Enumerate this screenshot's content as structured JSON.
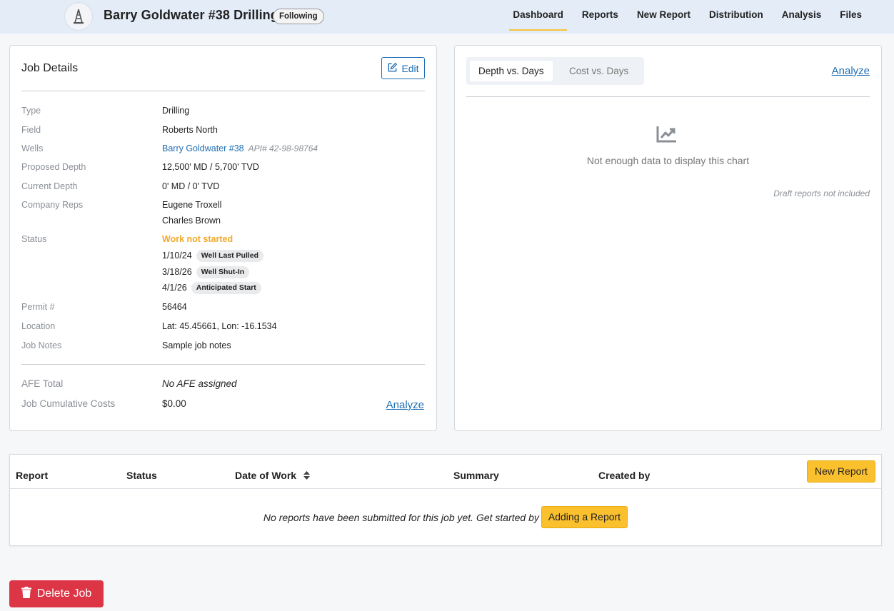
{
  "header": {
    "title": "Barry Goldwater #38 Drilling",
    "following_badge": "Following",
    "nav": [
      {
        "label": "Dashboard",
        "active": true
      },
      {
        "label": "Reports",
        "active": false
      },
      {
        "label": "New Report",
        "active": false
      },
      {
        "label": "Distribution",
        "active": false
      },
      {
        "label": "Analysis",
        "active": false
      },
      {
        "label": "Files",
        "active": false
      }
    ]
  },
  "job_details": {
    "title": "Job Details",
    "edit_label": "Edit",
    "fields": {
      "type": {
        "label": "Type",
        "value": "Drilling"
      },
      "field": {
        "label": "Field",
        "value": "Roberts North"
      },
      "wells": {
        "label": "Wells",
        "value": "Barry Goldwater #38",
        "api": "API# 42-98-98764"
      },
      "proposed_depth": {
        "label": "Proposed Depth",
        "value": "12,500' MD / 5,700' TVD"
      },
      "current_depth": {
        "label": "Current Depth",
        "value": "0' MD / 0' TVD"
      },
      "company_reps": {
        "label": "Company Reps",
        "values": [
          "Eugene Troxell",
          "Charles Brown"
        ]
      },
      "status": {
        "label": "Status",
        "value": "Work not started",
        "dates": [
          {
            "date": "1/10/24",
            "tag": "Well Last Pulled"
          },
          {
            "date": "3/18/26",
            "tag": "Well Shut-In"
          },
          {
            "date": "4/1/26",
            "tag": "Anticipated Start"
          }
        ]
      },
      "permit": {
        "label": "Permit #",
        "value": "56464"
      },
      "location": {
        "label": "Location",
        "value": "Lat: 45.45661, Lon: -16.1534"
      },
      "job_notes": {
        "label": "Job Notes",
        "value": "Sample job notes"
      }
    },
    "afe_total": {
      "label": "AFE Total",
      "value": "No AFE assigned"
    },
    "cumulative_costs": {
      "label": "Job Cumulative Costs",
      "value": "$0.00"
    },
    "analyze_label": "Analyze"
  },
  "chart_panel": {
    "tabs": [
      {
        "label": "Depth vs. Days",
        "active": true
      },
      {
        "label": "Cost vs. Days",
        "active": false
      }
    ],
    "analyze_label": "Analyze",
    "empty_message": "Not enough data to display this chart",
    "draft_note": "Draft reports not included",
    "icon": "chart-line-icon"
  },
  "reports_table": {
    "columns": [
      "Report",
      "Status",
      "Date of Work",
      "Summary",
      "Created by"
    ],
    "new_report_label": "New Report",
    "empty_text": "No reports have been submitted for this job yet. Get started by",
    "add_report_label": "Adding a Report"
  },
  "delete_label": "Delete Job",
  "colors": {
    "header_bg": "#e3ecf7",
    "accent_yellow": "#fbc02d",
    "link_blue": "#1f6fb5",
    "status_orange": "#f0a92b",
    "danger_red": "#dc3545"
  }
}
